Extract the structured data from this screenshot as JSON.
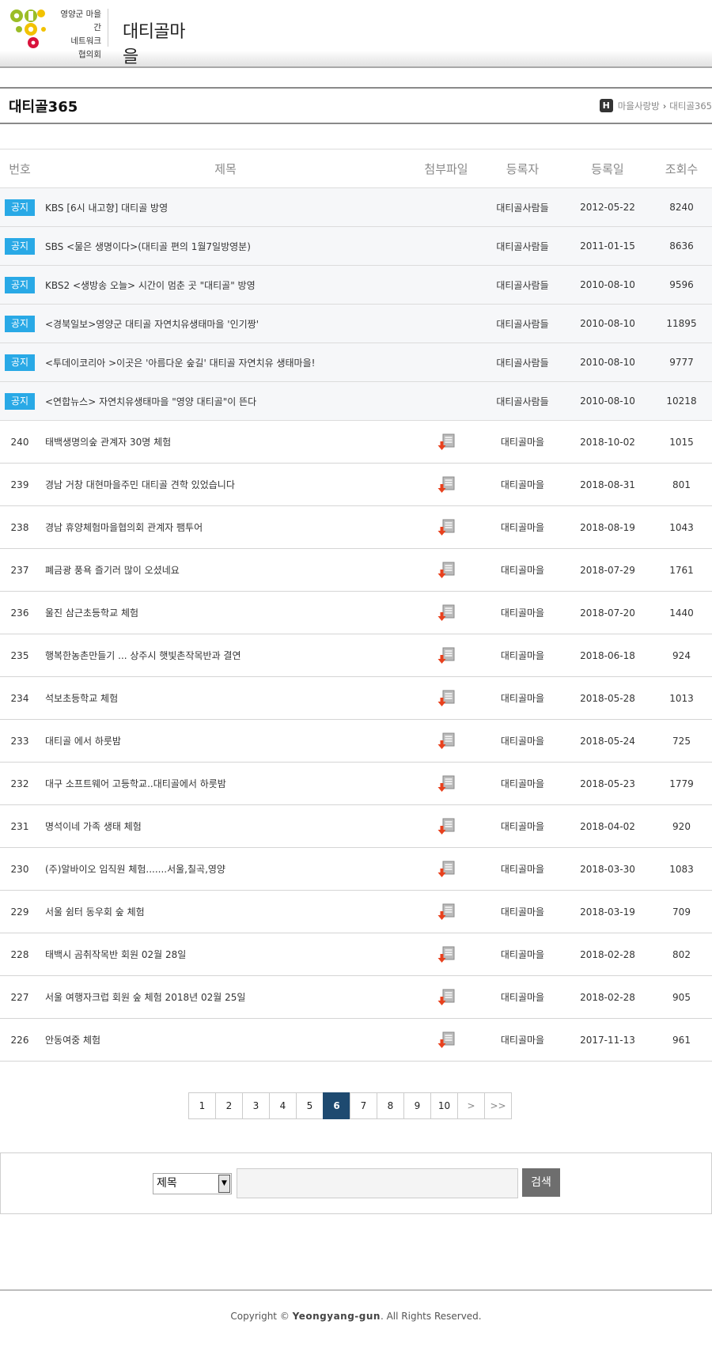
{
  "header": {
    "logo_lines": [
      "영양군 마을 간",
      "네트워크",
      "협의회"
    ],
    "village_name": "대티골마을"
  },
  "page": {
    "title": "대티골365",
    "breadcrumb": [
      "마을사랑방",
      "대티골365"
    ],
    "home_label": "H"
  },
  "table": {
    "headers": [
      "번호",
      "제목",
      "첨부파일",
      "등록자",
      "등록일",
      "조회수"
    ],
    "notices": [
      {
        "badge": "공지",
        "title": "KBS [6시 내고향] 대티골 방영",
        "author": "대티골사람들",
        "date": "2012-05-22",
        "views": "8240"
      },
      {
        "badge": "공지",
        "title": "SBS <물은 생명이다>(대티골 편의 1월7일방영분)",
        "author": "대티골사람들",
        "date": "2011-01-15",
        "views": "8636"
      },
      {
        "badge": "공지",
        "title": "KBS2 <생방송 오늘> 시간이 멈춘 곳 \"대티골\" 방영",
        "author": "대티골사람들",
        "date": "2010-08-10",
        "views": "9596"
      },
      {
        "badge": "공지",
        "title": "<경북일보>영양군 대티골 자연치유생태마을 '인기짱'",
        "author": "대티골사람들",
        "date": "2010-08-10",
        "views": "11895"
      },
      {
        "badge": "공지",
        "title": "<투데이코리아 >이곳은 '아름다운 숲길' 대티골 자연치유 생태마을!",
        "author": "대티골사람들",
        "date": "2010-08-10",
        "views": "9777"
      },
      {
        "badge": "공지",
        "title": "<연합뉴스> 자연치유생태마을 \"영양 대티골\"이 뜬다",
        "author": "대티골사람들",
        "date": "2010-08-10",
        "views": "10218"
      }
    ],
    "posts": [
      {
        "no": "240",
        "title": "태백생명의숲 관계자 30명 체험",
        "author": "대티골마을",
        "date": "2018-10-02",
        "views": "1015"
      },
      {
        "no": "239",
        "title": "경남 거창 대현마을주민 대티골 견학 있었습니다",
        "author": "대티골마을",
        "date": "2018-08-31",
        "views": "801"
      },
      {
        "no": "238",
        "title": "경남 휴양체험마을협의회 관계자 팸투어",
        "author": "대티골마을",
        "date": "2018-08-19",
        "views": "1043"
      },
      {
        "no": "237",
        "title": "폐금광 풍욕 즐기러 많이 오셨네요",
        "author": "대티골마을",
        "date": "2018-07-29",
        "views": "1761"
      },
      {
        "no": "236",
        "title": "울진 삼근초등학교 체험",
        "author": "대티골마을",
        "date": "2018-07-20",
        "views": "1440"
      },
      {
        "no": "235",
        "title": "행복한농촌만들기 ... 상주시 햇빛촌작목반과 결연",
        "author": "대티골마을",
        "date": "2018-06-18",
        "views": "924"
      },
      {
        "no": "234",
        "title": "석보초등학교 체험",
        "author": "대티골마을",
        "date": "2018-05-28",
        "views": "1013"
      },
      {
        "no": "233",
        "title": "대티골 에서 하룻밤",
        "author": "대티골마을",
        "date": "2018-05-24",
        "views": "725"
      },
      {
        "no": "232",
        "title": "대구 소프트웨어 고등학교..대티골에서 하룻밤",
        "author": "대티골마을",
        "date": "2018-05-23",
        "views": "1779"
      },
      {
        "no": "231",
        "title": "명석이네 가족 생태 체험",
        "author": "대티골마을",
        "date": "2018-04-02",
        "views": "920"
      },
      {
        "no": "230",
        "title": "(주)알바이오 임직원 체험.......서울,칠곡,영양",
        "author": "대티골마을",
        "date": "2018-03-30",
        "views": "1083"
      },
      {
        "no": "229",
        "title": "서울 쉼터 동우회 숲 체험",
        "author": "대티골마을",
        "date": "2018-03-19",
        "views": "709"
      },
      {
        "no": "228",
        "title": "태백시 곰취작목반 회원 02월 28일",
        "author": "대티골마을",
        "date": "2018-02-28",
        "views": "802"
      },
      {
        "no": "227",
        "title": "서울 여행자크럽 회원 숲 체험 2018년 02월 25일",
        "author": "대티골마을",
        "date": "2018-02-28",
        "views": "905"
      },
      {
        "no": "226",
        "title": "안동여중 체험",
        "author": "대티골마을",
        "date": "2017-11-13",
        "views": "961"
      }
    ]
  },
  "pagination": {
    "pages": [
      "1",
      "2",
      "3",
      "4",
      "5",
      "6",
      "7",
      "8",
      "9",
      "10"
    ],
    "active": "6",
    "next_label": ">",
    "last_label": ">>"
  },
  "search": {
    "select_value": "제목",
    "input_value": "",
    "button_label": "검색"
  },
  "footer": {
    "prefix": "Copyright © ",
    "brand": "Yeongyang-gun",
    "suffix": ". All Rights Reserved."
  },
  "colors": {
    "notice_badge": "#29a9e6",
    "active_page": "#1e4a70",
    "search_button": "#6e6e6e",
    "file_icon_arrow": "#e8411e"
  },
  "icons": {
    "file": "file-download-icon",
    "home": "home-icon"
  }
}
